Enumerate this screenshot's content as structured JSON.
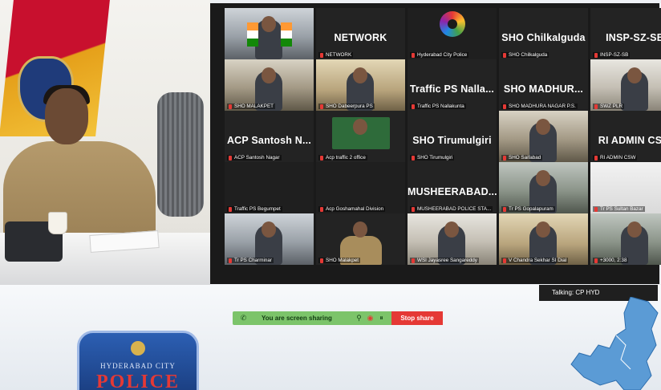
{
  "gallery": {
    "tiles": [
      {
        "id": "t1",
        "big": "",
        "caption": "",
        "video": "room1",
        "active": true,
        "flags": true
      },
      {
        "id": "t2",
        "big": "NETWORK",
        "caption": "NETWORK",
        "video": "none"
      },
      {
        "id": "t3",
        "big": "",
        "caption": "Hyderabad City Police",
        "video": "logo"
      },
      {
        "id": "t4",
        "big": "SHO Chilkalguda",
        "caption": "SHO Chilkalguda",
        "video": "none"
      },
      {
        "id": "t5",
        "big": "INSP-SZ-SB",
        "caption": "INSP-SZ-SB",
        "video": "none"
      },
      {
        "id": "t6",
        "big": "",
        "caption": "SHO MALAKPET",
        "video": "room3"
      },
      {
        "id": "t7",
        "big": "",
        "caption": "SHO Dabeerpura PS",
        "video": "room2"
      },
      {
        "id": "t8",
        "big": "Traffic PS Nalla...",
        "caption": "Traffic PS Nallakunta",
        "video": "none"
      },
      {
        "id": "t9",
        "big": "SHO MADHUR...",
        "caption": "SHO MADHURA NAGAR P.S.",
        "video": "none"
      },
      {
        "id": "t10",
        "big": "",
        "caption": "SWZ PLR",
        "video": "room5"
      },
      {
        "id": "t11",
        "big": "ACP Santosh N...",
        "caption": "ACP Santosh Nagar",
        "video": "none"
      },
      {
        "id": "t12",
        "big": "",
        "caption": "Acp traffic 2 office",
        "video": "green"
      },
      {
        "id": "t13",
        "big": "SHO Tirumulgiri",
        "caption": "SHO Tirumulgiri",
        "video": "none"
      },
      {
        "id": "t14",
        "big": "",
        "caption": "SHO Saifabad",
        "video": "room3"
      },
      {
        "id": "t15",
        "big": "RI ADMIN CSW",
        "caption": "RI ADMIN CSW",
        "video": "none"
      },
      {
        "id": "t16",
        "big": "",
        "caption": "Traffic PS Begumpet",
        "video": "dark"
      },
      {
        "id": "t17",
        "big": "",
        "caption": "Acp Goshamahal Division",
        "video": "dark"
      },
      {
        "id": "t18",
        "big": "MUSHEERABAD...",
        "caption": "MUSHEERABAD POLICE STA...",
        "video": "none"
      },
      {
        "id": "t19",
        "big": "",
        "caption": "Tr PS Gopalapuram",
        "video": "room4"
      },
      {
        "id": "t20",
        "big": "",
        "caption": "Tr PS Sultan Bazar",
        "video": "map"
      },
      {
        "id": "t21",
        "big": "",
        "caption": "Tr PS Charminar",
        "video": "room1"
      },
      {
        "id": "t22",
        "big": "",
        "caption": "SHO Malakpet",
        "video": "khaki"
      },
      {
        "id": "t23",
        "big": "",
        "caption": "WSI Jayasree Sangareddy",
        "video": "room5"
      },
      {
        "id": "t24",
        "big": "",
        "caption": "V Chandra Sekhar SI Dial",
        "video": "room2"
      },
      {
        "id": "t25",
        "big": "",
        "caption": "+3000, 2:38",
        "video": "room4"
      }
    ]
  },
  "talking": {
    "text": "Talking: CP HYD"
  },
  "share_bar": {
    "label": "You are screen sharing",
    "stop_label": "Stop share",
    "accent_green": "#7cc46a",
    "accent_red": "#e53935"
  },
  "logo": {
    "line1": "HYDERABAD CITY",
    "line2": "POLICE"
  },
  "icons": {
    "phone": "phone-icon",
    "pin": "pin-icon",
    "record": "record-icon",
    "pause": "pause-icon"
  }
}
